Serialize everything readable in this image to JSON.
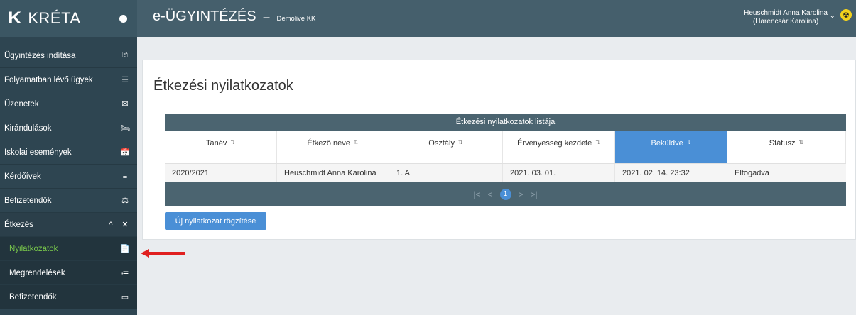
{
  "brand": {
    "logo": "K",
    "name": "KRÉTA"
  },
  "header": {
    "title": "e-ÜGYINTÉZÉS",
    "separator": "–",
    "org": "Demolive KK",
    "user_name": "Heuschmidt Anna Karolina",
    "user_sub": "(Harencsár Karolina)",
    "chevron": "⌄",
    "badge": "☢"
  },
  "sidebar": {
    "items": [
      {
        "label": "Ügyintézés indítása",
        "icon": "🗈"
      },
      {
        "label": "Folyamatban lévő ügyek",
        "icon": "☰"
      },
      {
        "label": "Üzenetek",
        "icon": "✉"
      },
      {
        "label": "Kirándulások",
        "icon": "🛏"
      },
      {
        "label": "Iskolai események",
        "icon": "📅"
      },
      {
        "label": "Kérdőívek",
        "icon": "≡"
      },
      {
        "label": "Befizetendők",
        "icon": "⚖"
      }
    ],
    "group": {
      "label": "Étkezés",
      "chevron": "^",
      "icon": "✕"
    },
    "subitems": [
      {
        "label": "Nyilatkozatok",
        "icon": "📄"
      },
      {
        "label": "Megrendelések",
        "icon": "≔"
      },
      {
        "label": "Befizetendők",
        "icon": "▭"
      }
    ]
  },
  "main": {
    "page_title": "Étkezési nyilatkozatok",
    "table": {
      "caption": "Étkezési nyilatkozatok listája",
      "columns": [
        {
          "label": "Tanév",
          "sort": "⇅"
        },
        {
          "label": "Étkező neve",
          "sort": "⇅"
        },
        {
          "label": "Osztály",
          "sort": "⇅"
        },
        {
          "label": "Érvényesség kezdete",
          "sort": "⇅"
        },
        {
          "label": "Beküldve",
          "sort": "⇂"
        },
        {
          "label": "Státusz",
          "sort": "⇅"
        }
      ],
      "rows": [
        [
          "2020/2021",
          "Heuschmidt Anna Karolina",
          "1. A",
          "2021. 03. 01.",
          "2021. 02. 14. 23:32",
          "Elfogadva"
        ]
      ],
      "pager": {
        "first": "|<",
        "prev": "<",
        "current": "1",
        "next": ">",
        "last": ">|"
      }
    },
    "new_button": "Új nyilatkozat rögzítése"
  },
  "colors": {
    "accent": "#4a8fd6",
    "active_menu": "#79c84b",
    "annotation_arrow": "#e02020"
  }
}
